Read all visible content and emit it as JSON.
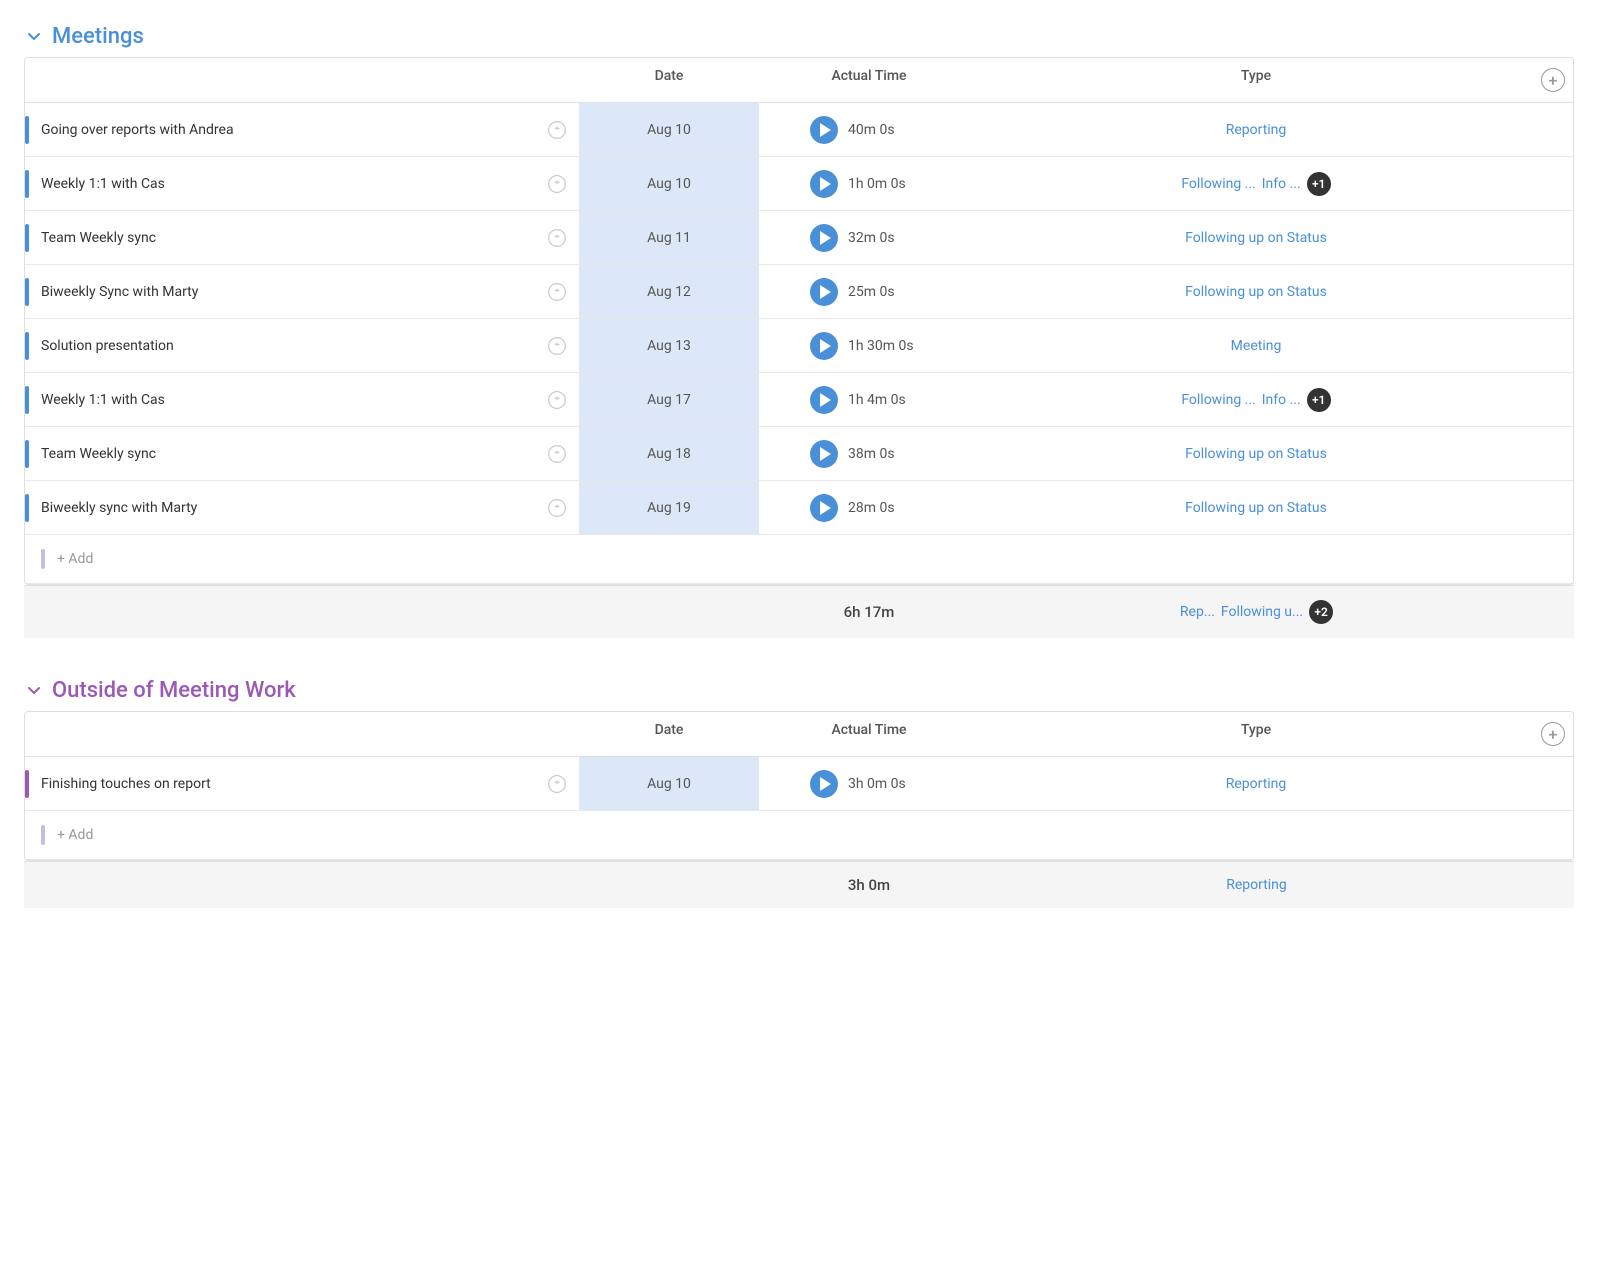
{
  "meetings": {
    "section_title": "Meetings",
    "columns": {
      "date": "Date",
      "actual_time": "Actual Time",
      "type": "Type"
    },
    "rows": [
      {
        "id": 1,
        "name": "Going over reports with Andrea",
        "date": "Aug 10",
        "actual_time": "40m 0s",
        "types": [
          {
            "label": "Reporting",
            "truncated": false
          }
        ],
        "badge": null
      },
      {
        "id": 2,
        "name": "Weekly 1:1 with Cas",
        "date": "Aug 10",
        "actual_time": "1h 0m 0s",
        "types": [
          {
            "label": "Following ...",
            "truncated": true
          },
          {
            "label": "Info ...",
            "truncated": true
          }
        ],
        "badge": "+1"
      },
      {
        "id": 3,
        "name": "Team Weekly sync",
        "date": "Aug 11",
        "actual_time": "32m 0s",
        "types": [
          {
            "label": "Following up on Status",
            "truncated": false
          }
        ],
        "badge": null
      },
      {
        "id": 4,
        "name": "Biweekly Sync with Marty",
        "date": "Aug 12",
        "actual_time": "25m 0s",
        "types": [
          {
            "label": "Following up on Status",
            "truncated": false
          }
        ],
        "badge": null
      },
      {
        "id": 5,
        "name": "Solution presentation",
        "date": "Aug 13",
        "actual_time": "1h 30m 0s",
        "types": [
          {
            "label": "Meeting",
            "truncated": false
          }
        ],
        "badge": null
      },
      {
        "id": 6,
        "name": "Weekly 1:1 with Cas",
        "date": "Aug 17",
        "actual_time": "1h 4m 0s",
        "types": [
          {
            "label": "Following ...",
            "truncated": true
          },
          {
            "label": "Info ...",
            "truncated": true
          }
        ],
        "badge": "+1"
      },
      {
        "id": 7,
        "name": "Team Weekly sync",
        "date": "Aug 18",
        "actual_time": "38m 0s",
        "types": [
          {
            "label": "Following up on Status",
            "truncated": false
          }
        ],
        "badge": null
      },
      {
        "id": 8,
        "name": "Biweekly sync with Marty",
        "date": "Aug 19",
        "actual_time": "28m 0s",
        "types": [
          {
            "label": "Following up on Status",
            "truncated": false
          }
        ],
        "badge": null
      }
    ],
    "add_label": "+ Add",
    "summary_time": "6h 17m",
    "summary_types": [
      {
        "label": "Rep...",
        "truncated": true
      },
      {
        "label": "Following u...",
        "truncated": true
      }
    ],
    "summary_badge": "+2"
  },
  "outside": {
    "section_title": "Outside of Meeting Work",
    "columns": {
      "date": "Date",
      "actual_time": "Actual Time",
      "type": "Type"
    },
    "rows": [
      {
        "id": 1,
        "name": "Finishing touches on report",
        "date": "Aug 10",
        "actual_time": "3h 0m 0s",
        "types": [
          {
            "label": "Reporting",
            "truncated": false
          }
        ],
        "badge": null
      }
    ],
    "add_label": "+ Add",
    "summary_time": "3h 0m",
    "summary_types": [
      {
        "label": "Reporting",
        "truncated": false
      }
    ],
    "summary_badge": null
  }
}
